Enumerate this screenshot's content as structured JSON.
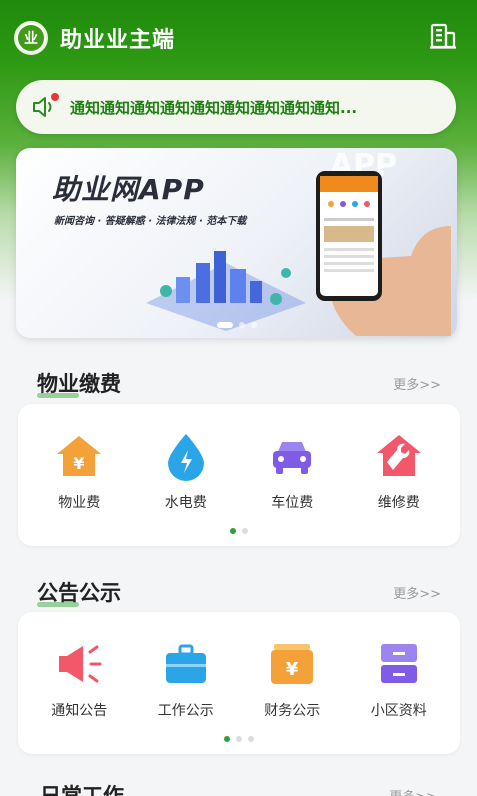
{
  "header": {
    "title": "助业业主端",
    "logo_text": "业"
  },
  "notice": {
    "text": "通知通知通知通知通知通知通知通知通知..."
  },
  "banner": {
    "title": "助业网APP",
    "subtitle": "新闻咨询 · 答疑解惑 · 法律法规 · 范本下载",
    "watermark": "APP"
  },
  "sections": [
    {
      "title": "物业缴费",
      "more": "更多>>",
      "items": [
        {
          "label": "物业费",
          "icon": "property-fee-icon",
          "color": "#f5a13a"
        },
        {
          "label": "水电费",
          "icon": "water-electric-icon",
          "color": "#2aa6e8"
        },
        {
          "label": "车位费",
          "icon": "parking-fee-icon",
          "color": "#7f5be6"
        },
        {
          "label": "维修费",
          "icon": "repair-fee-icon",
          "color": "#f2586a"
        }
      ]
    },
    {
      "title": "公告公示",
      "more": "更多>>",
      "items": [
        {
          "label": "通知公告",
          "icon": "announcement-icon",
          "color": "#f2586a"
        },
        {
          "label": "工作公示",
          "icon": "work-publicity-icon",
          "color": "#2aa6e8"
        },
        {
          "label": "财务公示",
          "icon": "finance-publicity-icon",
          "color": "#f5a13a"
        },
        {
          "label": "小区资料",
          "icon": "community-info-icon",
          "color": "#7f5be6"
        }
      ]
    }
  ],
  "next_section": {
    "title": "日常工作",
    "more": "更多>>"
  }
}
